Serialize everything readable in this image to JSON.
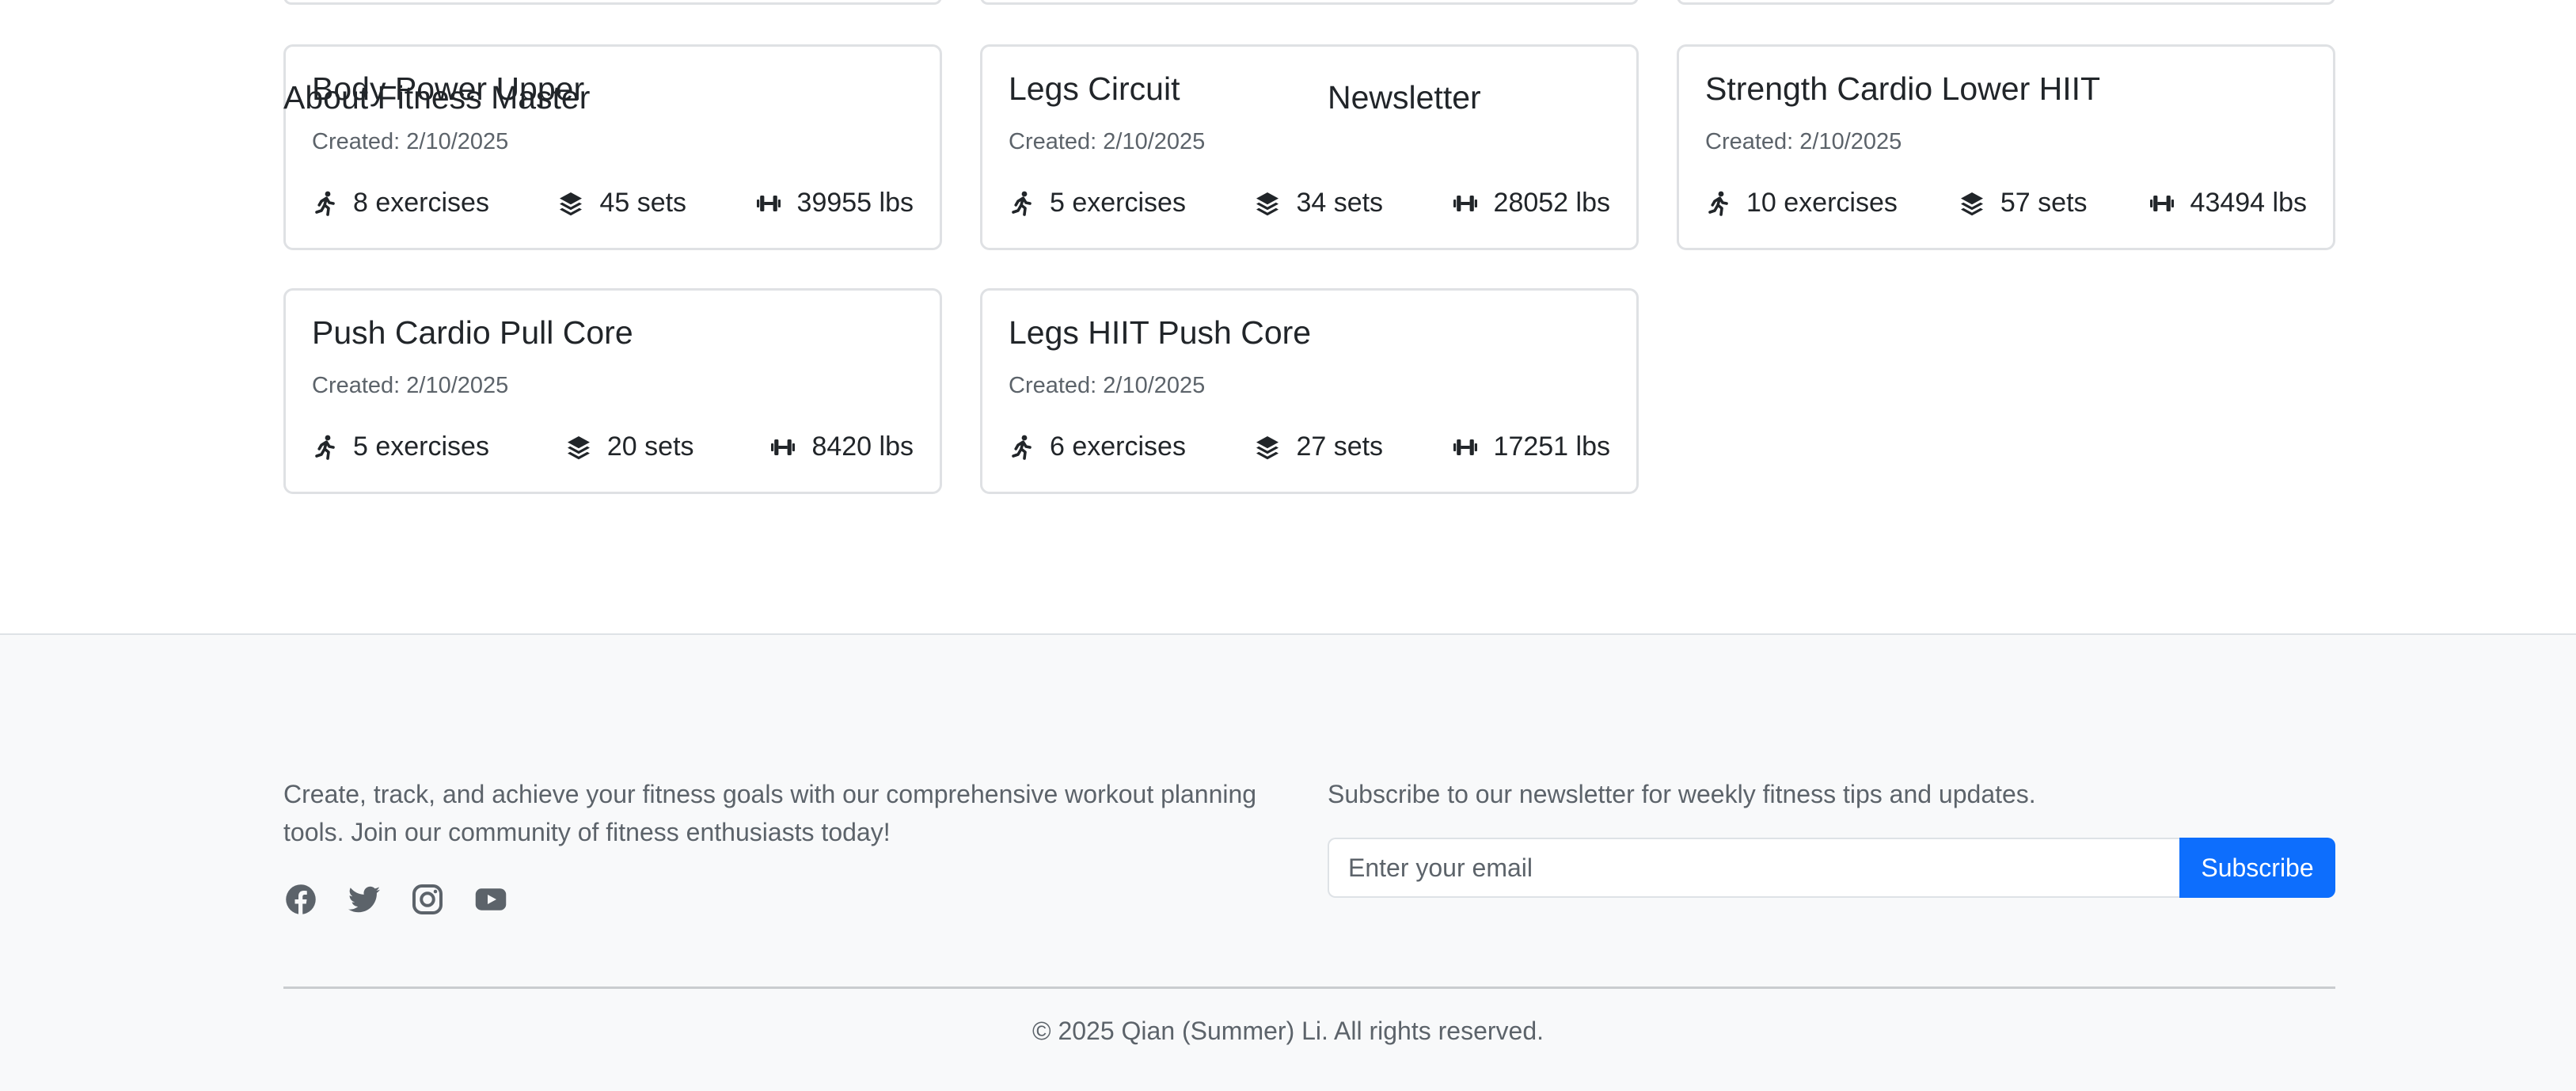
{
  "workouts": [
    {
      "title": "Body Power Upper",
      "created": "Created: 2/10/2025",
      "exercises": "8 exercises",
      "sets": "45 sets",
      "weight": "39955 lbs"
    },
    {
      "title": "Legs Circuit",
      "created": "Created: 2/10/2025",
      "exercises": "5 exercises",
      "sets": "34 sets",
      "weight": "28052 lbs"
    },
    {
      "title": "Strength Cardio Lower HIIT",
      "created": "Created: 2/10/2025",
      "exercises": "10 exercises",
      "sets": "57 sets",
      "weight": "43494 lbs"
    },
    {
      "title": "Push Cardio Pull Core",
      "created": "Created: 2/10/2025",
      "exercises": "5 exercises",
      "sets": "20 sets",
      "weight": "8420 lbs"
    },
    {
      "title": "Legs HIIT Push Core",
      "created": "Created: 2/10/2025",
      "exercises": "6 exercises",
      "sets": "27 sets",
      "weight": "17251 lbs"
    }
  ],
  "icons": {
    "exercises": "running-person-icon",
    "sets": "layers-icon",
    "weight": "dumbbell-icon"
  },
  "footer": {
    "about_title": "About Fitness Master",
    "about_text": "Create, track, and achieve your fitness goals with our comprehensive workout planning tools. Join our community of fitness enthusiasts today!",
    "socials": [
      "facebook-icon",
      "twitter-icon",
      "instagram-icon",
      "youtube-icon"
    ],
    "newsletter_title": "Newsletter",
    "newsletter_text": "Subscribe to our newsletter for weekly fitness tips and updates.",
    "email_placeholder": "Enter your email",
    "subscribe_label": "Subscribe",
    "copyright": "© 2025 Qian (Summer) Li. All rights reserved."
  },
  "colors": {
    "primary": "#0d6efd",
    "footer_bg": "#f8f9fa",
    "muted_text": "#5c636a"
  }
}
